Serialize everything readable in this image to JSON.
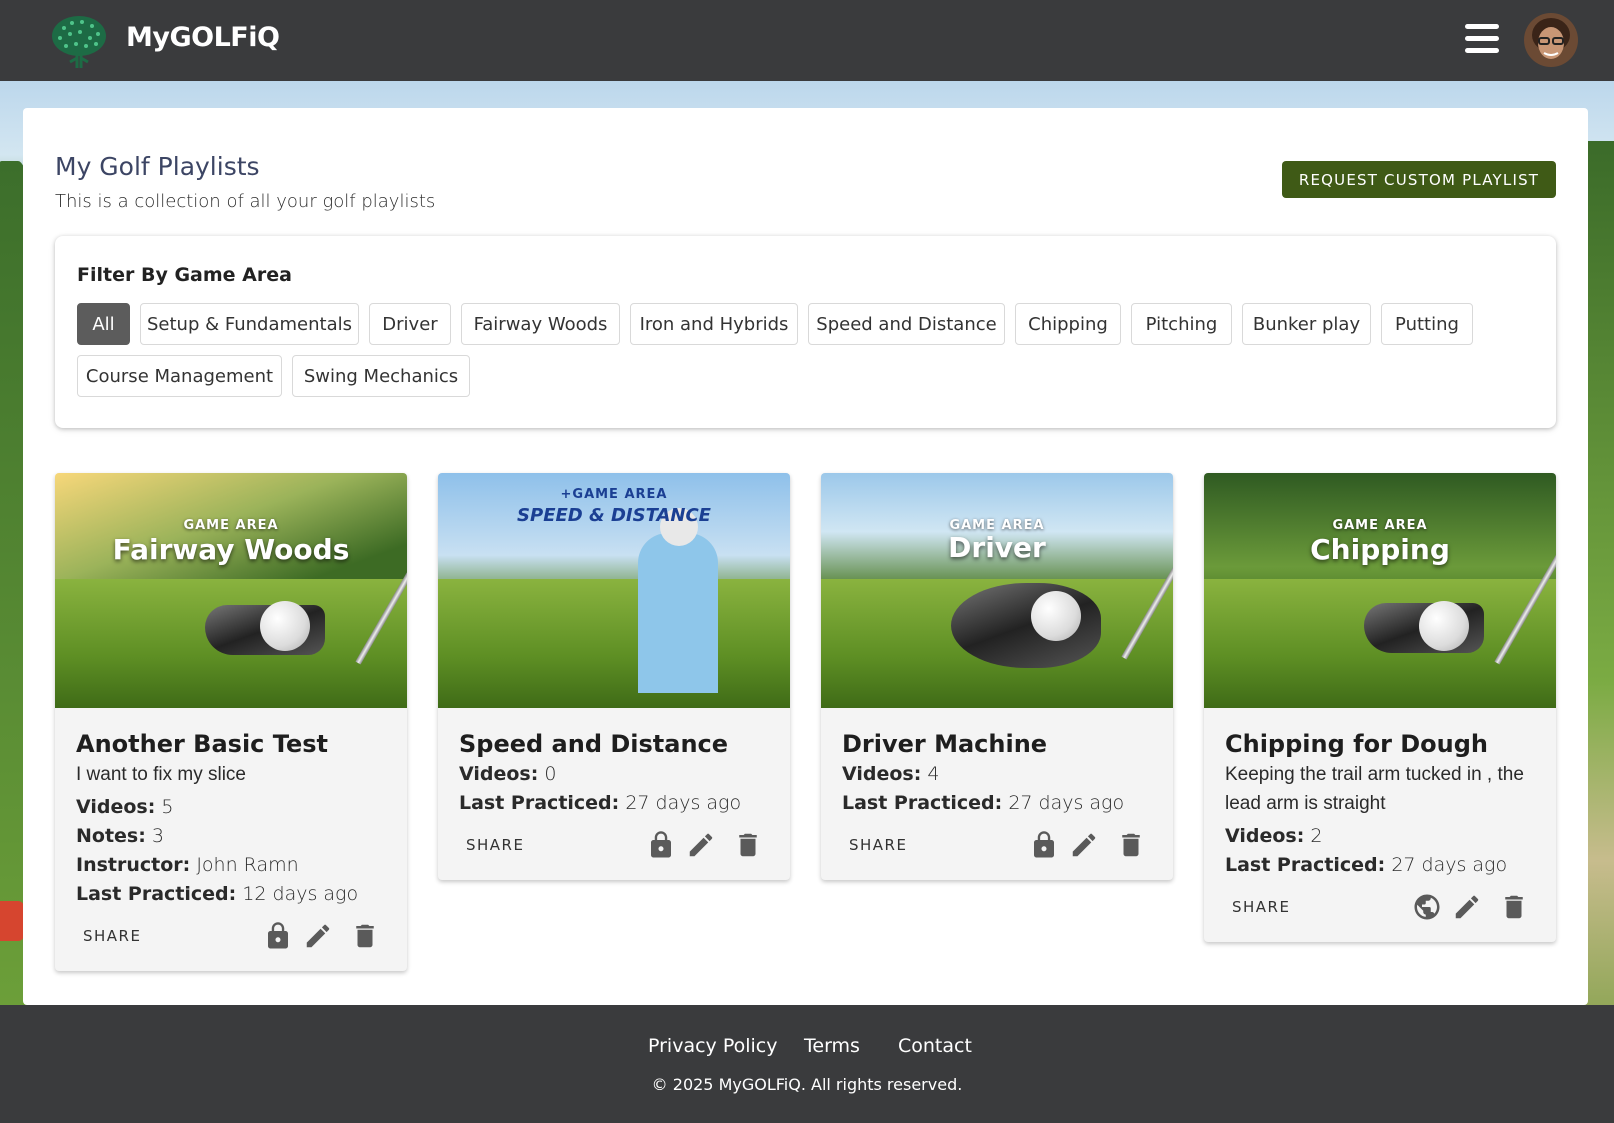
{
  "header": {
    "brand": "MyGOLFiQ",
    "menu_icon": "hamburger-icon",
    "avatar_icon": "user-avatar"
  },
  "page": {
    "title": "My Golf Playlists",
    "subtitle": "This is a collection of all your golf playlists",
    "request_button": "REQUEST CUSTOM PLAYLIST"
  },
  "filter": {
    "title": "Filter By Game Area",
    "chips": [
      "All",
      "Setup & Fundamentals",
      "Driver",
      "Fairway Woods",
      "Iron and Hybrids",
      "Speed and Distance",
      "Chipping",
      "Pitching",
      "Bunker play",
      "Putting",
      "Course Management",
      "Swing Mechanics"
    ],
    "selected": "All"
  },
  "cards": [
    {
      "thumb_top": "GAME AREA",
      "thumb_name": "Fairway Woods",
      "title": "Another Basic Test",
      "description": "I want to fix my slice",
      "videos_label": "Videos:",
      "videos": "5",
      "notes_label": "Notes:",
      "notes": "3",
      "instructor_label": "Instructor:",
      "instructor": "John Ramn",
      "practiced_label": "Last Practiced:",
      "practiced": "12 days ago",
      "share": "SHARE",
      "visibility_icon": "lock-icon"
    },
    {
      "thumb_top": "+GAME AREA",
      "thumb_name": "SPEED & DISTANCE",
      "title": "Speed and Distance",
      "videos_label": "Videos:",
      "videos": "0",
      "practiced_label": "Last Practiced:",
      "practiced": "27 days ago",
      "share": "SHARE",
      "visibility_icon": "lock-icon"
    },
    {
      "thumb_top": "GAME AREA",
      "thumb_name": "Driver",
      "title": "Driver Machine",
      "videos_label": "Videos:",
      "videos": "4",
      "practiced_label": "Last Practiced:",
      "practiced": "27 days ago",
      "share": "SHARE",
      "visibility_icon": "lock-icon"
    },
    {
      "thumb_top": "GAME AREA",
      "thumb_name": "Chipping",
      "title": "Chipping for Dough",
      "description": "Keeping the trail arm tucked in , the lead arm is straight",
      "videos_label": "Videos:",
      "videos": "2",
      "practiced_label": "Last Practiced:",
      "practiced": "27 days ago",
      "share": "SHARE",
      "visibility_icon": "globe-icon"
    }
  ],
  "footer": {
    "links": [
      "Privacy Policy",
      "Terms",
      "Contact"
    ],
    "copyright": "© 2025 MyGOLFiQ. All rights reserved."
  },
  "colors": {
    "header_bg": "#3a3b3d",
    "request_button": "#3f5a16",
    "active_chip": "#5c5c5c",
    "icon": "#5a5a5a"
  }
}
